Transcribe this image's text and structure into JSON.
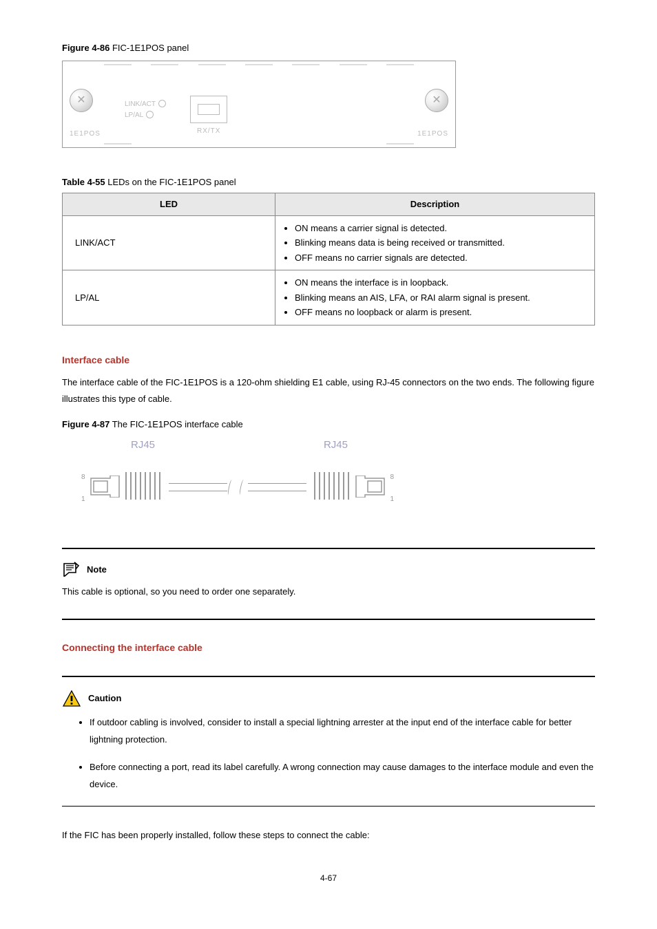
{
  "figure86": {
    "label": "Figure 4-86",
    "title": " FIC-1E1POS panel"
  },
  "panel": {
    "model_left": "1E1POS",
    "model_right": "1E1POS",
    "led1": "LINK/ACT",
    "led2": "LP/AL",
    "port_label": "RX/TX"
  },
  "table55": {
    "label": "Table 4-55",
    "title": " LEDs on the FIC-1E1POS panel",
    "header_led": "LED",
    "header_desc": "Description",
    "rows": [
      {
        "led": "LINK/ACT",
        "bullets": [
          "ON means a carrier signal is detected.",
          "Blinking means data is being received or transmitted.",
          "OFF means no carrier signals are detected."
        ]
      },
      {
        "led": "LP/AL",
        "bullets": [
          "ON means the interface is in loopback.",
          "Blinking means an AIS, LFA, or RAI alarm signal is present.",
          "OFF means no loopback or alarm is present."
        ]
      }
    ]
  },
  "interface_cable": {
    "heading": "Interface cable",
    "paragraph": "The interface cable of the FIC-1E1POS is a 120-ohm shielding E1 cable, using RJ-45 connectors on the two ends. The following figure illustrates this type of cable."
  },
  "figure87": {
    "label": "Figure 4-87",
    "title": " The FIC-1E1POS interface cable"
  },
  "cable": {
    "rj45": "RJ45",
    "pin8": "8",
    "pin1": "1"
  },
  "note": {
    "label": "Note",
    "text": "This cable is optional, so you need to order one separately."
  },
  "connecting": {
    "heading": "Connecting the interface cable"
  },
  "caution": {
    "label": "Caution",
    "bullets": [
      "If outdoor cabling is involved, consider to install a special lightning arrester at the input end of the interface cable for better lightning protection.",
      "Before connecting a port, read its label carefully. A wrong connection may cause damages to the interface module and even the device."
    ]
  },
  "closing": "If the FIC has been properly installed, follow these steps to connect the cable:",
  "footer": "4-67"
}
